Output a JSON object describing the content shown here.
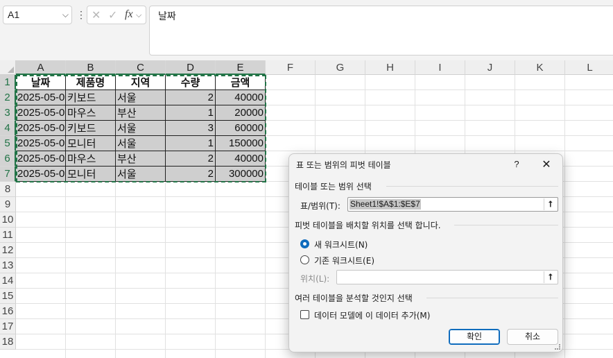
{
  "formula_bar": {
    "name_box": "A1",
    "cancel_glyph": "✕",
    "enter_glyph": "✓",
    "fx_label": "fx",
    "content": "날짜"
  },
  "grid": {
    "columns": [
      "A",
      "B",
      "C",
      "D",
      "E",
      "F",
      "G",
      "H",
      "I",
      "J",
      "K",
      "L"
    ],
    "rows": [
      "1",
      "2",
      "3",
      "4",
      "5",
      "6",
      "7",
      "8",
      "9",
      "10",
      "11",
      "12",
      "13",
      "14",
      "15",
      "16",
      "17",
      "18"
    ],
    "headers": [
      "날짜",
      "제품명",
      "지역",
      "수량",
      "금액"
    ],
    "data": [
      [
        "2025-05-0",
        "키보드",
        "서울",
        "2",
        "40000"
      ],
      [
        "2025-05-0",
        "마우스",
        "부산",
        "1",
        "20000"
      ],
      [
        "2025-05-0",
        "키보드",
        "서울",
        "3",
        "60000"
      ],
      [
        "2025-05-0",
        "모니터",
        "서울",
        "1",
        "150000"
      ],
      [
        "2025-05-0",
        "마우스",
        "부산",
        "2",
        "40000"
      ],
      [
        "2025-05-0",
        "모니터",
        "서울",
        "2",
        "300000"
      ]
    ],
    "selection_color": "#217346"
  },
  "dialog": {
    "title": "표 또는 범위의 피벗 테이블",
    "help": "?",
    "close": "✕",
    "section_source": "테이블 또는 범위 선택",
    "range_label": "표/범위(T):",
    "range_value": "Sheet1!$A$1:$E$7",
    "section_location": "피벗 테이블을 배치할 위치를 선택 합니다.",
    "option_new": "새 워크시트(N)",
    "option_existing": "기존 워크시트(E)",
    "location_label": "위치(L):",
    "location_value": "",
    "section_multi": "여러 테이블을 분석할 것인지 선택",
    "datamodel_label": "데이터 모델에 이 데이터 추가(M)",
    "ok": "확인",
    "cancel": "취소",
    "accent": "#0f6cbd"
  }
}
